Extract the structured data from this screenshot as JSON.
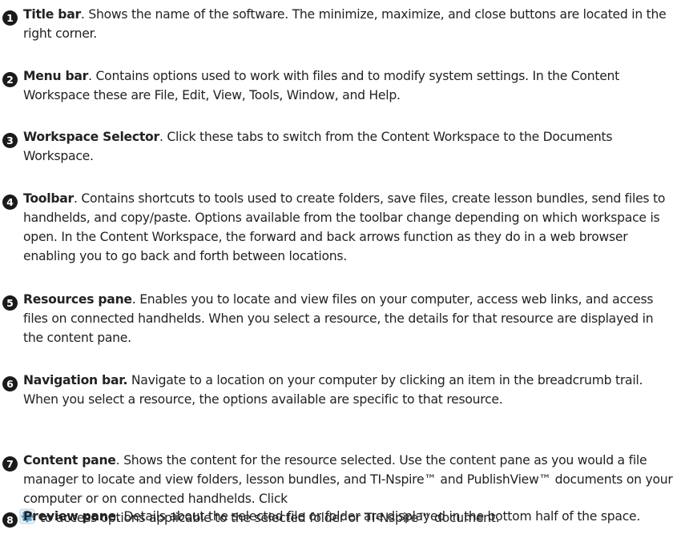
{
  "items": [
    {
      "number": "1",
      "term": "Title bar",
      "term_suffix": ".",
      "description": " Shows the name of the software. The minimize, maximize, and close buttons are located in the right corner."
    },
    {
      "number": "2",
      "term": "Menu bar",
      "term_suffix": ".",
      "description": " Contains options used to work with files and to modify system settings. In the Content Workspace these are File, Edit, View, Tools, Window, and Help."
    },
    {
      "number": "3",
      "term": "Workspace Selector",
      "term_suffix": ".",
      "description": " Click these tabs to switch from the Content Workspace to the Documents Workspace."
    },
    {
      "number": "4",
      "term": "Toolbar",
      "term_suffix": ".",
      "description": " Contains shortcuts to tools used to create folders, save files, create lesson bundles, send files to handhelds, and copy/paste. Options available from the toolbar change depending on which workspace is open. In the Content Workspace, the forward and back arrows function as they do in a web browser enabling you to go back and forth between locations."
    },
    {
      "number": "5",
      "term": "Resources pane",
      "term_suffix": ".",
      "description": " Enables you to locate and view files on your computer, access web links, and access files on connected handhelds. When you select a resource, the details for that resource are displayed in the content pane."
    },
    {
      "number": "6",
      "term": "Navigation bar.",
      "term_suffix": "",
      "description": " Navigate to a location on your computer by clicking an item in the breadcrumb trail. When you select a resource, the options available are specific to that resource."
    },
    {
      "number": "7",
      "term": "Content pane",
      "term_suffix": ".",
      "description": " Shows the content for the resource selected. Use the content pane as you would a file manager to locate and view folders, lesson bundles, and TI-Nspire™ and PublishView™ documents on your computer or on connected handhelds. Click",
      "description_after_icon": "to access options applicable to the selected folder or TI-Nspire™ document.",
      "inline_icon": "gear-icon"
    },
    {
      "number": "8",
      "term": "Preview pane",
      "term_suffix": ".",
      "description": " Details about the selected file or folder are displayed in the bottom half of the space."
    }
  ],
  "colors": {
    "text": "#222222",
    "badge": "#1a1a1a",
    "badge_text": "#ffffff"
  }
}
